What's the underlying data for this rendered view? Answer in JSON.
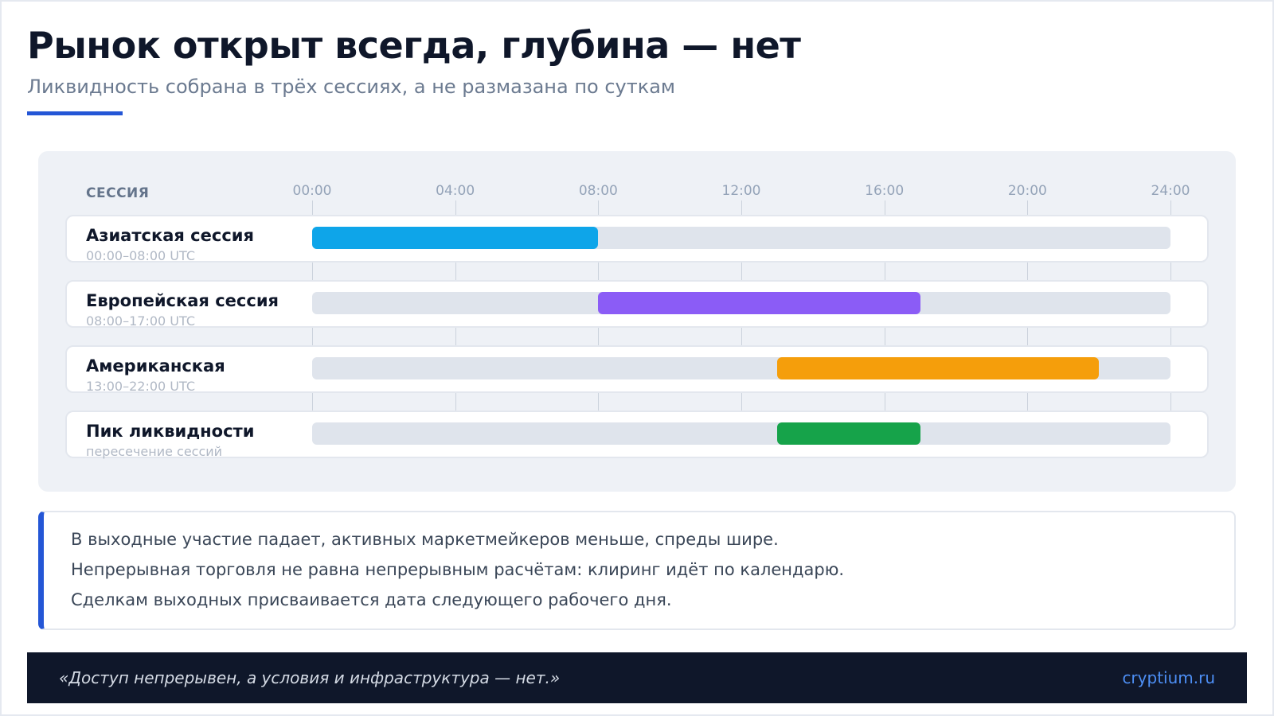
{
  "header": {
    "title": "Рынок открыт всегда, глубина — нет",
    "subtitle": "Ликвидность собрана в трёх сессиях, а не размазана по суткам",
    "accent_color": "#2456d6"
  },
  "chart_data": {
    "type": "timeline",
    "column_header": "СЕССИЯ",
    "x_ticks": [
      "00:00",
      "04:00",
      "08:00",
      "12:00",
      "16:00",
      "20:00",
      "24:00"
    ],
    "x_range": [
      0,
      24
    ],
    "rows": [
      {
        "name": "Азиатская сессия",
        "sub": "00:00–08:00 UTC",
        "start": 0,
        "end": 8,
        "color": "#0ea5e9"
      },
      {
        "name": "Европейская сессия",
        "sub": "08:00–17:00 UTC",
        "start": 8,
        "end": 17,
        "color": "#8b5cf6"
      },
      {
        "name": "Американская",
        "sub": "13:00–22:00 UTC",
        "start": 13,
        "end": 22,
        "color": "#f59e0b"
      },
      {
        "name": "Пик ликвидности",
        "sub": "пересечение сессий",
        "start": 13,
        "end": 17,
        "color": "#16a34a"
      }
    ]
  },
  "notes": {
    "lines": [
      "В выходные участие падает, активных маркетмейкеров меньше, спреды шире.",
      "Непрерывная торговля не равна непрерывным расчётам: клиринг идёт по календарю.",
      "Сделкам выходных присваивается дата следующего рабочего дня."
    ]
  },
  "footer": {
    "quote": "«Доступ непрерывен, а условия и инфраструктура — нет.»",
    "brand": "cryptium.ru"
  }
}
